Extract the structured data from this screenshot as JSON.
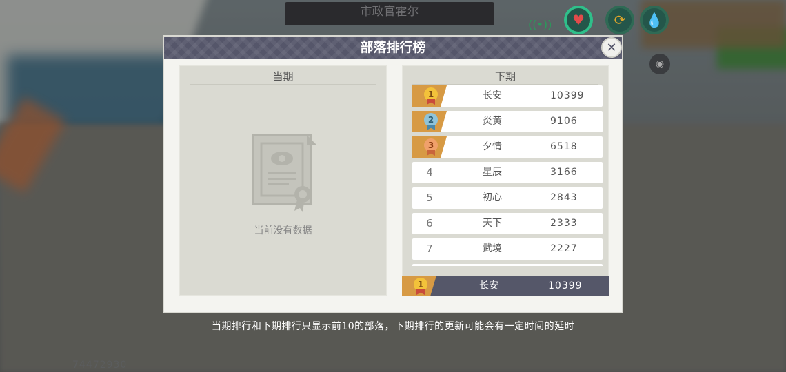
{
  "top_banner": "市政官霍尔",
  "hud": {
    "icons": [
      "heart-icon",
      "sync-icon",
      "water-drop-icon"
    ],
    "heart_glyph": "♥",
    "sync_glyph": "⟳",
    "water_glyph": "💧",
    "signal_glyph": "((•))",
    "eye_glyph": "◉",
    "player_id": "74472930"
  },
  "panel": {
    "title": "部落排行榜",
    "close_glyph": "✕",
    "current": {
      "title": "当期",
      "empty_text": "当前没有数据"
    },
    "next": {
      "title": "下期",
      "rows": [
        {
          "rank": "1",
          "name": "长安",
          "score": "10399",
          "medal": "gold"
        },
        {
          "rank": "2",
          "name": "炎黄",
          "score": "9106",
          "medal": "silver"
        },
        {
          "rank": "3",
          "name": "夕情",
          "score": "6518",
          "medal": "bronze"
        },
        {
          "rank": "4",
          "name": "星辰",
          "score": "3166",
          "medal": ""
        },
        {
          "rank": "5",
          "name": "初心",
          "score": "2843",
          "medal": ""
        },
        {
          "rank": "6",
          "name": "天下",
          "score": "2333",
          "medal": ""
        },
        {
          "rank": "7",
          "name": "武境",
          "score": "2227",
          "medal": ""
        }
      ],
      "my_tribe": {
        "rank": "1",
        "name": "长安",
        "score": "10399"
      }
    }
  },
  "footer_note": "当期排行和下期排行只显示前10的部落，下期排行的更新可能会有一定时间的延时",
  "colors": {
    "gold": "#f3c23a",
    "silver": "#8fc3d8",
    "bronze": "#f0a06a"
  }
}
